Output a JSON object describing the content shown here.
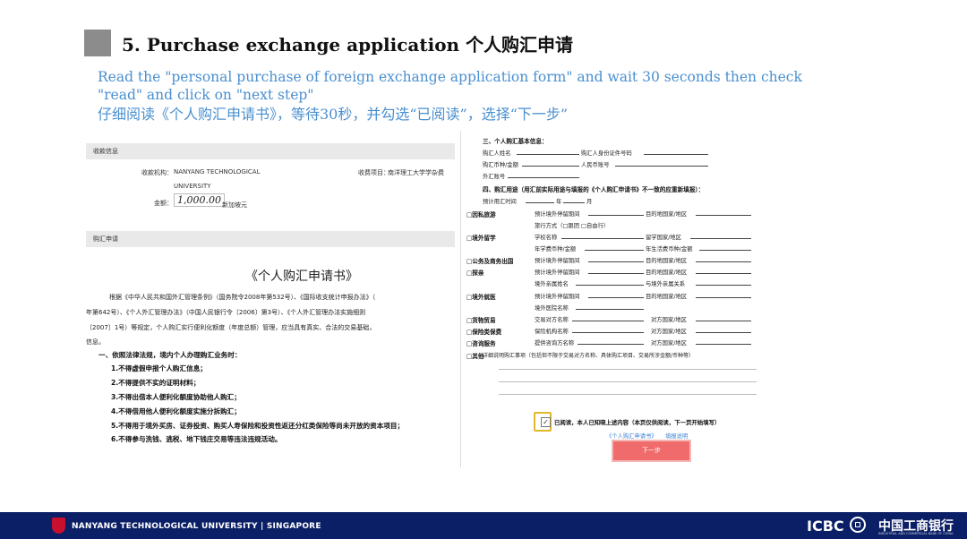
{
  "slide": {
    "title": "5. Purchase exchange application 个人购汇申请",
    "instructions": [
      "Read the \"personal purchase of foreign exchange application form\" and wait 30 seconds then  check",
      "\"read\"  and click on  \"next step\"",
      "仔细阅读《个人购汇申请书》，等待30秒，并勾选“已阅读”，选择“下一步”"
    ]
  },
  "left_panel": {
    "payee_header": "收款信息",
    "payee_label": "收款机构：",
    "payee_value_1": "NANYANG TECHNOLOGICAL",
    "payee_value_2": "UNIVERSITY",
    "item_label": "收费项目：",
    "item_value": "南洋理工大学学杂费",
    "amount_label": "金额：",
    "amount_value": "1,000.00",
    "currency": "新加坡元",
    "application_header": "购汇申请",
    "doc_title": "《个人购汇申请书》",
    "doc_lines": [
      "根据《中华人民共和国外汇管理条例》（国务院令2008年第532号）、《国际收支统计申报办法》（",
      "年第642号）、《个人外汇管理办法》（中国人民银行令〔2006〕第3号）、《个人外汇管理办法实施细则",
      "〔2007〕1号）等规定，个人购汇实行便利化额度（年度总额）管理，应当具有真实、合法的交易基础，",
      "信息。"
    ],
    "duties_heading": "一、依照法律法规，境内个人办理购汇业务时：",
    "duties": [
      "1.不得虚假申报个人购汇信息；",
      "2.不得提供不实的证明材料；",
      "3.不得出借本人便利化额度协助他人购汇；",
      "4.不得借用他人便利化额度实施分拆购汇；",
      "5.不得用于境外买房、证券投资、购买人寿保险和投资性返还分红类保险等尚未开放的资本项目；",
      "6.不得参与洗钱、逃税、地下钱庄交易等违法违规活动。"
    ]
  },
  "right_panel": {
    "section3": "三、个人购汇基本信息：",
    "name_label": "购汇人姓名",
    "id_label": "购汇人身份证件号码",
    "account_label": "购汇币种/金额",
    "rmb_account_label": "人民币账号",
    "fx_account_label": "外汇账号",
    "section4": "四、购汇用途（用汇前实际用途与填报的《个人购汇申请书》不一致的应重新填报）：",
    "date_label": "预计用汇时间",
    "year": "年",
    "month": "月",
    "purposes": [
      {
        "name": "□因私旅游",
        "fields": [
          "预计境外停留期间",
          "目的地国家/地区"
        ]
      },
      {
        "name": "",
        "fields": [
          "旅行方式（□跟团 □自由行）"
        ]
      },
      {
        "name": "□境外留学",
        "fields": [
          "学校名称",
          "留学国家/地区"
        ]
      },
      {
        "name": "",
        "fields": [
          "年学费币种/金额",
          "年生活费币种/金额"
        ]
      },
      {
        "name": "□公务及商务出国",
        "fields": [
          "预计境外停留期间",
          "目的地国家/地区"
        ]
      },
      {
        "name": "□探亲",
        "fields": [
          "预计境外停留期间",
          "目的地国家/地区"
        ]
      },
      {
        "name": "",
        "fields": [
          "境外亲属姓名",
          "与境外亲属关系"
        ]
      },
      {
        "name": "□境外就医",
        "fields": [
          "预计境外停留期间",
          "目的地国家/地区"
        ]
      },
      {
        "name": "",
        "fields": [
          "境外医院名称"
        ]
      },
      {
        "name": "□货物贸易",
        "fields": [
          "交易对方名称",
          "对方国家/地区"
        ]
      },
      {
        "name": "□保险类保费",
        "fields": [
          "保险机构名称",
          "对方国家/地区"
        ]
      },
      {
        "name": "□咨询服务",
        "fields": [
          "提供咨询方名称",
          "对方国家/地区"
        ]
      },
      {
        "name": "□其他",
        "fields": [
          "详细说明购汇事项（包括但不限于交易对方名称、具体购汇项目、交易所涉金额/币种等）"
        ]
      }
    ],
    "read_check": "✓",
    "read_text": "已阅读，本人已知晓上述内容（本页仅供阅读，下一页开始填写）",
    "link_form": "《个人购汇申请书》",
    "link_help": "填报说明",
    "next_button": "下一步"
  },
  "footer": {
    "ntu_label": "NANYANG TECHNOLOGICAL UNIVERSITY | SINGAPORE",
    "icbc_en": "ICBC",
    "icbc_cn": "中国工商银行",
    "icbc_full": "INDUSTRIAL AND COMMERCIAL BANK OF CHINA",
    "colors": {
      "footer_bg": "#0b1f66",
      "instruction_text": "#4a8fd0",
      "button": "#f06b6b",
      "highlight": "#e3b72b"
    }
  }
}
